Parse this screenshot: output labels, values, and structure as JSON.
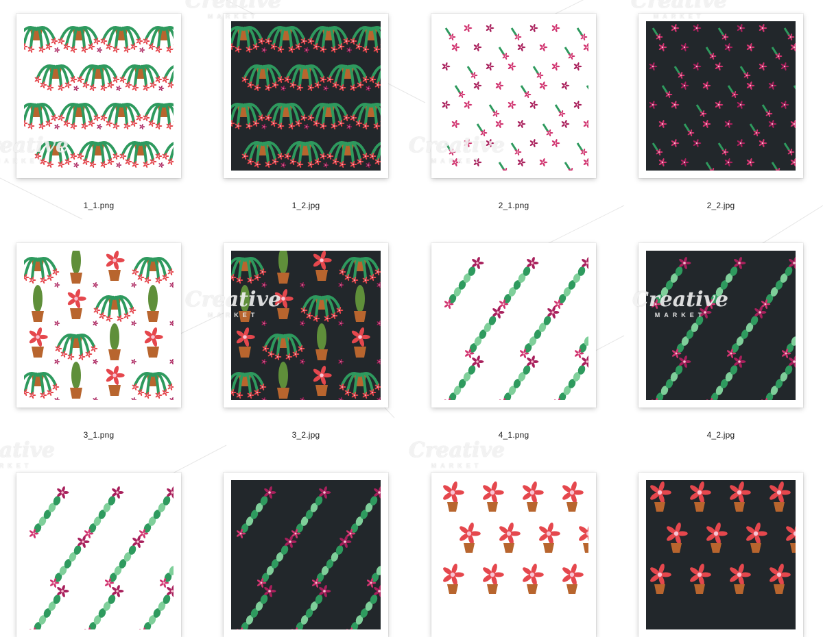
{
  "files": [
    {
      "name": "1_1.png",
      "bg": "#ffffff",
      "motif": "hanging-plant-icon"
    },
    {
      "name": "1_2.jpg",
      "bg": "#22272b",
      "motif": "hanging-plant-icon"
    },
    {
      "name": "2_1.png",
      "bg": "#ffffff",
      "motif": "pink-flower-icon"
    },
    {
      "name": "2_2.jpg",
      "bg": "#22272b",
      "motif": "pink-flower-icon"
    },
    {
      "name": "3_1.png",
      "bg": "#ffffff",
      "motif": "potted-plants-icon"
    },
    {
      "name": "3_2.jpg",
      "bg": "#22272b",
      "motif": "potted-plants-icon"
    },
    {
      "name": "4_1.png",
      "bg": "#ffffff",
      "motif": "cactus-branch-icon"
    },
    {
      "name": "4_2.jpg",
      "bg": "#22272b",
      "motif": "cactus-branch-icon"
    },
    {
      "name": "",
      "bg": "#ffffff",
      "motif": "cactus-branch-icon"
    },
    {
      "name": "",
      "bg": "#22272b",
      "motif": "cactus-branch-icon"
    },
    {
      "name": "",
      "bg": "#ffffff",
      "motif": "poinsettia-icon"
    },
    {
      "name": "",
      "bg": "#22272b",
      "motif": "poinsettia-icon"
    }
  ],
  "colors": {
    "leaf": "#2e9a5e",
    "leaf_light": "#7fcf9a",
    "flower_pink": "#d0336f",
    "flower_magenta": "#a8205c",
    "flower_red": "#e5474d",
    "pot": "#b8652e"
  },
  "watermark": {
    "text": "Creative",
    "sub": "MARKET"
  }
}
